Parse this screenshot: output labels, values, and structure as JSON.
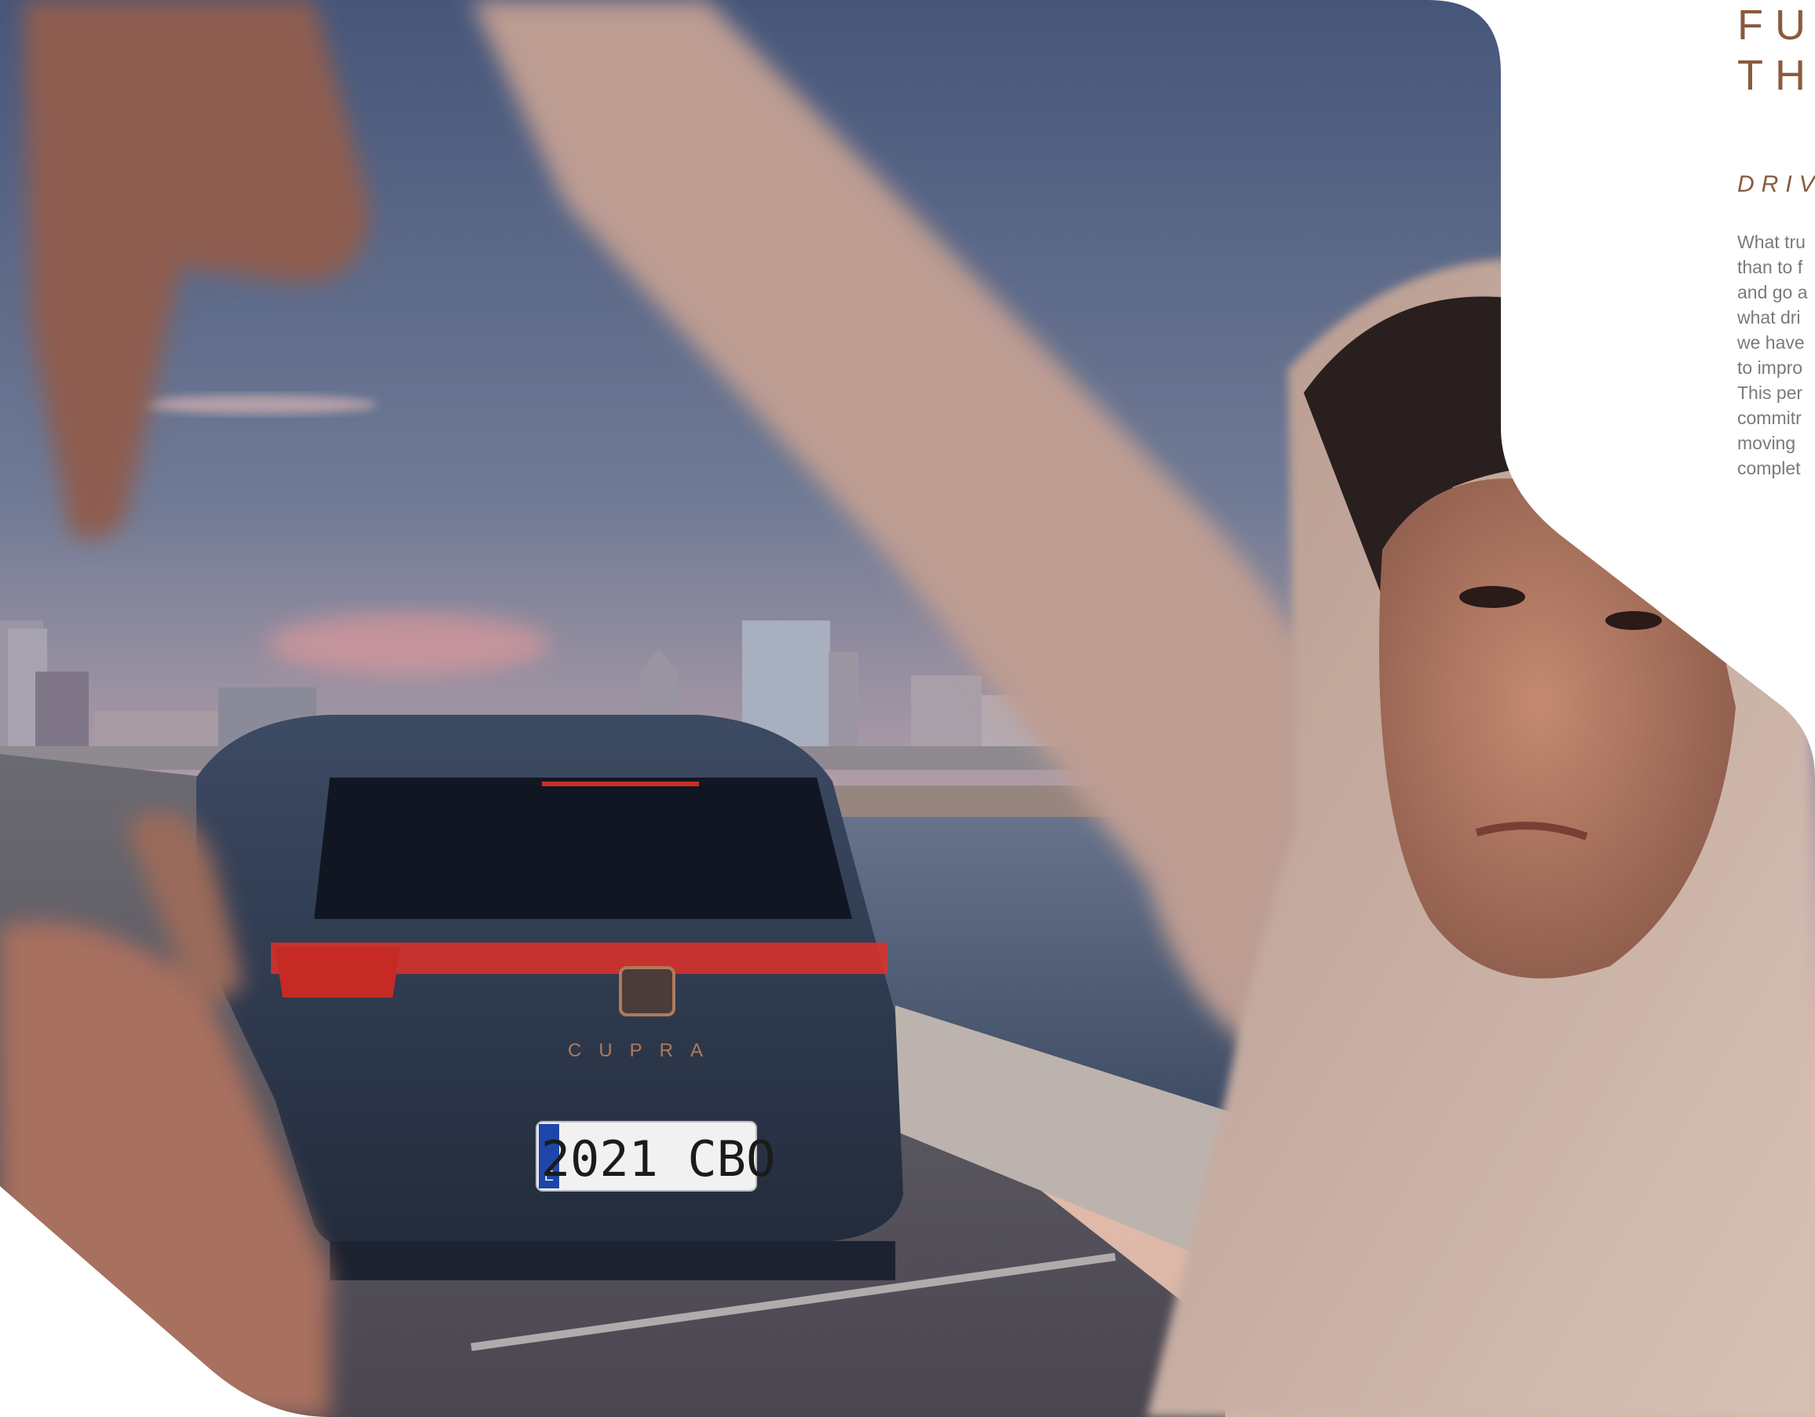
{
  "photo": {
    "subject": "car-photo",
    "license_plate": {
      "country_code": "E",
      "number": "2021 CBO"
    },
    "badge_text": "CUPRA",
    "colors": {
      "sky_top": "#4f5f82",
      "sky_horizon": "#e0b6ac",
      "water": "#4b5a72",
      "car_body": "#2e3a50",
      "tail_light": "#e0302a",
      "skin": "#b57a62",
      "sweater": "#cdb5a8"
    }
  },
  "copy": {
    "headline_line1": "FU",
    "headline_line2": "TH",
    "subhead": "DRIV",
    "body_lines": [
      "What tru",
      "than to f",
      "and go a",
      "what dri",
      "we have",
      "to impro",
      "This per",
      "commitr",
      "moving",
      "complet"
    ],
    "colors": {
      "heading": "#8a5a3e",
      "body": "#7a7a7a"
    }
  }
}
